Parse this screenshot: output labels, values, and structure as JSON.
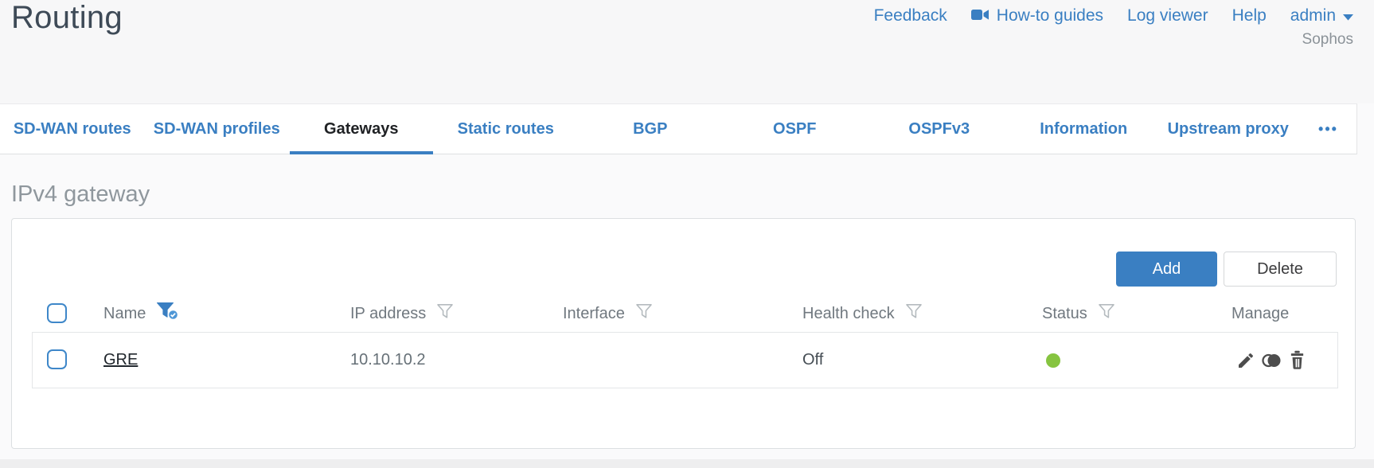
{
  "header": {
    "title": "Routing",
    "nav": {
      "feedback": "Feedback",
      "howto_guides": "How-to guides",
      "log_viewer": "Log viewer",
      "help": "Help",
      "user": "admin"
    },
    "brand": "Sophos"
  },
  "tabs": {
    "items": [
      {
        "label": "SD-WAN routes",
        "active": false
      },
      {
        "label": "SD-WAN profiles",
        "active": false
      },
      {
        "label": "Gateways",
        "active": true
      },
      {
        "label": "Static routes",
        "active": false
      },
      {
        "label": "BGP",
        "active": false
      },
      {
        "label": "OSPF",
        "active": false
      },
      {
        "label": "OSPFv3",
        "active": false
      },
      {
        "label": "Information",
        "active": false
      },
      {
        "label": "Upstream proxy",
        "active": false
      }
    ],
    "overflow_label": "•••"
  },
  "section": {
    "title": "IPv4 gateway"
  },
  "toolbar": {
    "add_label": "Add",
    "delete_label": "Delete"
  },
  "table": {
    "columns": [
      {
        "label": "Name",
        "filter": "active"
      },
      {
        "label": "IP address",
        "filter": "inactive"
      },
      {
        "label": "Interface",
        "filter": "inactive"
      },
      {
        "label": "Health check",
        "filter": "inactive"
      },
      {
        "label": "Status",
        "filter": "inactive"
      },
      {
        "label": "Manage",
        "filter": "none"
      }
    ],
    "rows": [
      {
        "name": "GRE",
        "ip": "10.10.10.2",
        "interface": "",
        "health_check": "Off",
        "status": "green",
        "manage_icons": [
          "edit-icon",
          "toggle-status-icon",
          "delete-icon"
        ]
      }
    ]
  },
  "icons": {
    "howto": "video-camera-icon",
    "user_menu": "chevron-down-icon",
    "filter": "funnel-icon",
    "filter_active": "funnel-active-icon",
    "overflow": "more-dots-icon"
  },
  "colors": {
    "accent_blue": "#3a7fc2",
    "active_tab_underline": "#3a7fc2",
    "status_green": "#86c440",
    "title_text": "#3e4a57",
    "column_header_text": "#70787f",
    "manage_icon_gray": "#4d4d4d"
  }
}
